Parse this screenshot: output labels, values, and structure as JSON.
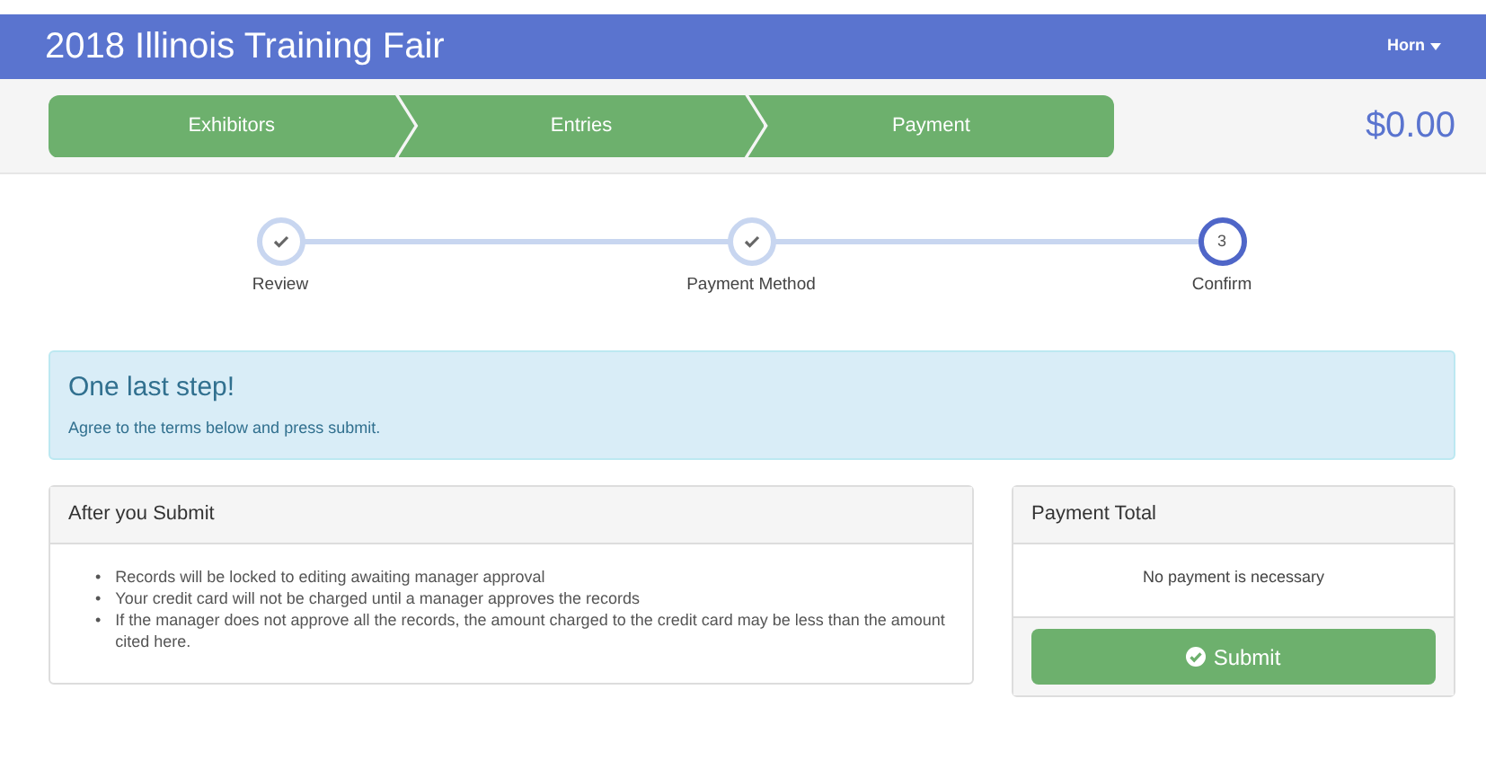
{
  "header": {
    "title": "2018 Illinois Training Fair",
    "user_menu": "Horn"
  },
  "breadcrumb": [
    "Exhibitors",
    "Entries",
    "Payment"
  ],
  "total": "$0.00",
  "steps": [
    {
      "label": "Review",
      "completed": true,
      "selected": false
    },
    {
      "label": "Payment Method",
      "completed": true,
      "selected": false
    },
    {
      "label": "Confirm",
      "completed": false,
      "selected": true,
      "number": "3"
    }
  ],
  "alert": {
    "heading": "One last step!",
    "text": "Agree to the terms below and press submit."
  },
  "after_submit": {
    "title": "After you Submit",
    "items": [
      {
        "bullet": "•",
        "text": "Records will be locked to editing awaiting manager approval"
      },
      {
        "bullet": "•",
        "text": "Your credit card will not be charged until a manager approves the records"
      },
      {
        "bullet": "•",
        "text": "If the manager does not approve all the records, the amount charged to the credit card may be less than the amount cited here."
      }
    ]
  },
  "payment": {
    "title": "Payment Total",
    "message": "No payment is necessary",
    "button": "Submit"
  }
}
